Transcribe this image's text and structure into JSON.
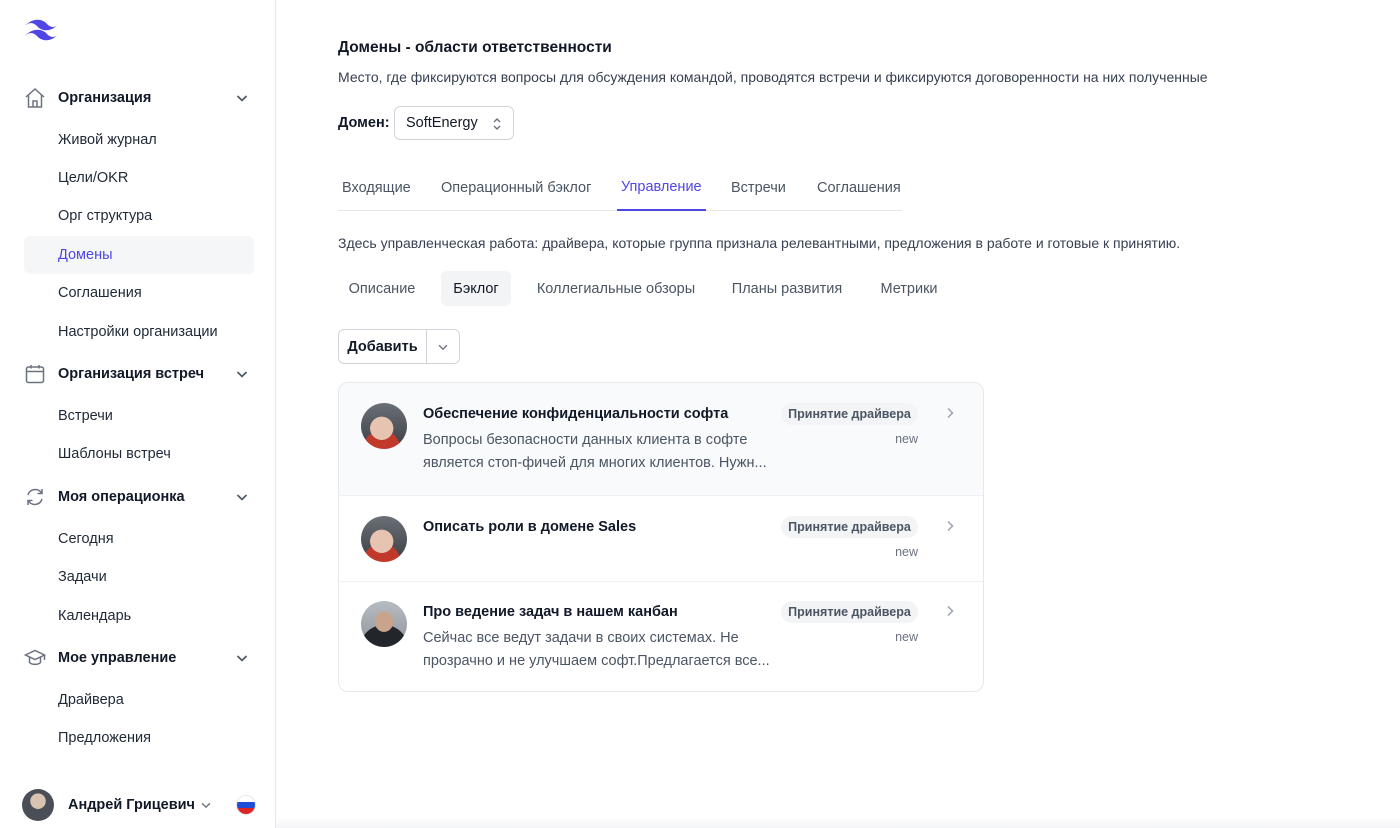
{
  "sidebar": {
    "groups": [
      {
        "label": "Организация",
        "icon": "home-icon",
        "items": [
          "Живой журнал",
          "Цели/OKR",
          "Орг структура",
          "Домены",
          "Соглашения",
          "Настройки организации"
        ]
      },
      {
        "label": "Организация встреч",
        "icon": "calendar-icon",
        "items": [
          "Встречи",
          "Шаблоны встреч"
        ]
      },
      {
        "label": "Моя операционка",
        "icon": "refresh-icon",
        "items": [
          "Сегодня",
          "Задачи",
          "Календарь"
        ]
      },
      {
        "label": "Мое управление",
        "icon": "graduation-cap-icon",
        "items": [
          "Драйвера",
          "Предложения"
        ]
      }
    ],
    "active_item": "Домены",
    "user": {
      "name": "Андрей Грицевич"
    },
    "colors": {
      "active_bg": "#f5f6f8",
      "accent": "#4f46e5"
    }
  },
  "main": {
    "title": "Домены - области ответственности",
    "description": "Место, где фиксируются вопросы для обсуждения командой, проводятся встречи и фиксируются договоренности на них полученные",
    "domain_label": "Домен:",
    "domain_value": "SoftEnergy",
    "tabs": [
      "Входящие",
      "Операционный бэклог",
      "Управление",
      "Встречи",
      "Соглашения"
    ],
    "active_tab": "Управление",
    "tab_description": "Здесь управленческая работа: драйвера, которые группа признала релевантными, предложения в работе и готовые к принятию.",
    "subtabs": [
      "Описание",
      "Бэклог",
      "Коллегиальные обзоры",
      "Планы развития",
      "Метрики"
    ],
    "active_subtab": "Бэклог",
    "add_button": "Добавить",
    "items": [
      {
        "title": "Обеспечение конфиденциальности софта",
        "description": "Вопросы безопасности данных клиента в софте является стоп-фичей для многих клиентов. Нужн...",
        "badge": "Принятие драйвера",
        "status": "new"
      },
      {
        "title": "Описать роли в домене Sales",
        "description": "",
        "badge": "Принятие драйвера",
        "status": "new"
      },
      {
        "title": "Про ведение задач в нашем канбан",
        "description": "Сейчас все ведут задачи в своих системах. Не прозрачно и не улучшаем софт.Предлагается все...",
        "badge": "Принятие драйвера",
        "status": "new"
      }
    ]
  }
}
